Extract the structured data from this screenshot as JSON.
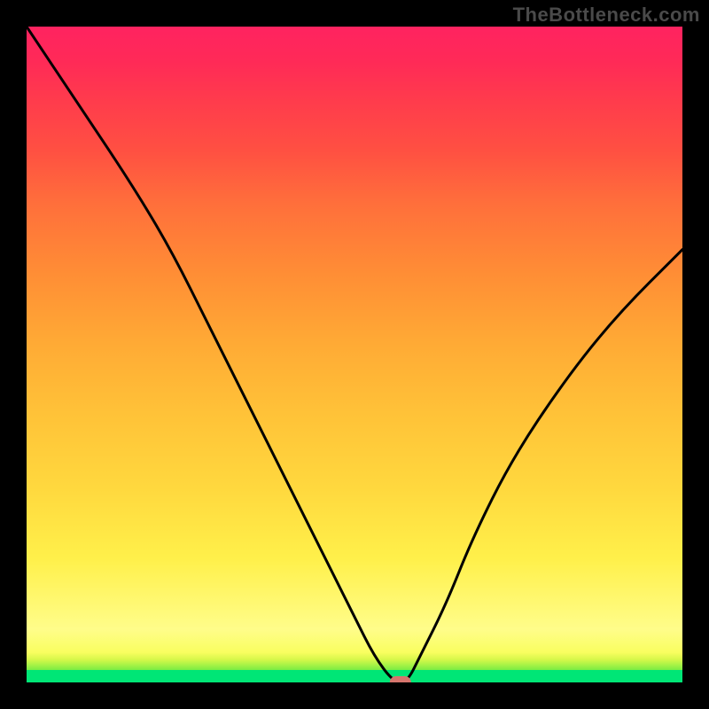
{
  "attribution": "TheBottleneck.com",
  "chart_data": {
    "type": "line",
    "title": "",
    "xlabel": "",
    "ylabel": "",
    "xlim": [
      0,
      100
    ],
    "ylim": [
      0,
      100
    ],
    "legend": false,
    "grid": false,
    "annotations": [],
    "series": [
      {
        "name": "bottleneck-curve",
        "x": [
          0,
          8,
          16,
          22,
          28,
          34,
          40,
          46,
          50,
          53,
          56,
          58,
          60,
          64,
          68,
          74,
          82,
          90,
          100
        ],
        "values": [
          100,
          88,
          76,
          66,
          54,
          42,
          30,
          18,
          10,
          4,
          0,
          0,
          4,
          12,
          22,
          34,
          46,
          56,
          66
        ]
      }
    ],
    "optimum": {
      "x": 57,
      "y": 0
    },
    "gradient_stops": [
      {
        "pct": 0,
        "color": "#00e676"
      },
      {
        "pct": 2,
        "color": "#00e676"
      },
      {
        "pct": 2,
        "color": "#7aed43"
      },
      {
        "pct": 4,
        "color": "#d8f84a"
      },
      {
        "pct": 5,
        "color": "#f9fe60"
      },
      {
        "pct": 8,
        "color": "#fffd8a"
      },
      {
        "pct": 19,
        "color": "#fff04a"
      },
      {
        "pct": 30,
        "color": "#ffd83e"
      },
      {
        "pct": 41,
        "color": "#ffc338"
      },
      {
        "pct": 51,
        "color": "#ffab35"
      },
      {
        "pct": 62,
        "color": "#ff8e35"
      },
      {
        "pct": 73,
        "color": "#ff6f3b"
      },
      {
        "pct": 81,
        "color": "#ff5042"
      },
      {
        "pct": 89,
        "color": "#ff3a4d"
      },
      {
        "pct": 95,
        "color": "#ff2a57"
      },
      {
        "pct": 100,
        "color": "#ff2360"
      }
    ],
    "marker_color": "#d6756d"
  }
}
